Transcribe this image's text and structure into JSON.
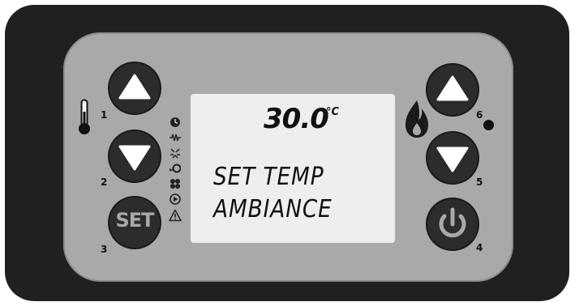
{
  "display": {
    "temperature": "30.0",
    "unit": "°C",
    "line1": "SET TEMP",
    "line2": "AMBIANCE"
  },
  "buttons": {
    "b1": {
      "number": "1",
      "icon": "triangle-up"
    },
    "b2": {
      "number": "2",
      "icon": "triangle-down"
    },
    "b3": {
      "number": "3",
      "label": "SET"
    },
    "b4": {
      "number": "4",
      "icon": "power-icon"
    },
    "b5": {
      "number": "5",
      "icon": "triangle-down"
    },
    "b6": {
      "number": "6",
      "icon": "triangle-up"
    }
  },
  "status_icons": [
    "clock-icon",
    "resistor-icon",
    "igniter-icon",
    "pump-icon",
    "fan-icon",
    "play-icon",
    "warning-icon"
  ],
  "side_icons": {
    "left": "thermometer-icon",
    "right": "flame-icon",
    "indicator": "led-dot"
  },
  "colors": {
    "frame": "#202020",
    "panel": "#a9a9a9",
    "lcd": "#eeeeee",
    "button": "#2c2c2c"
  }
}
